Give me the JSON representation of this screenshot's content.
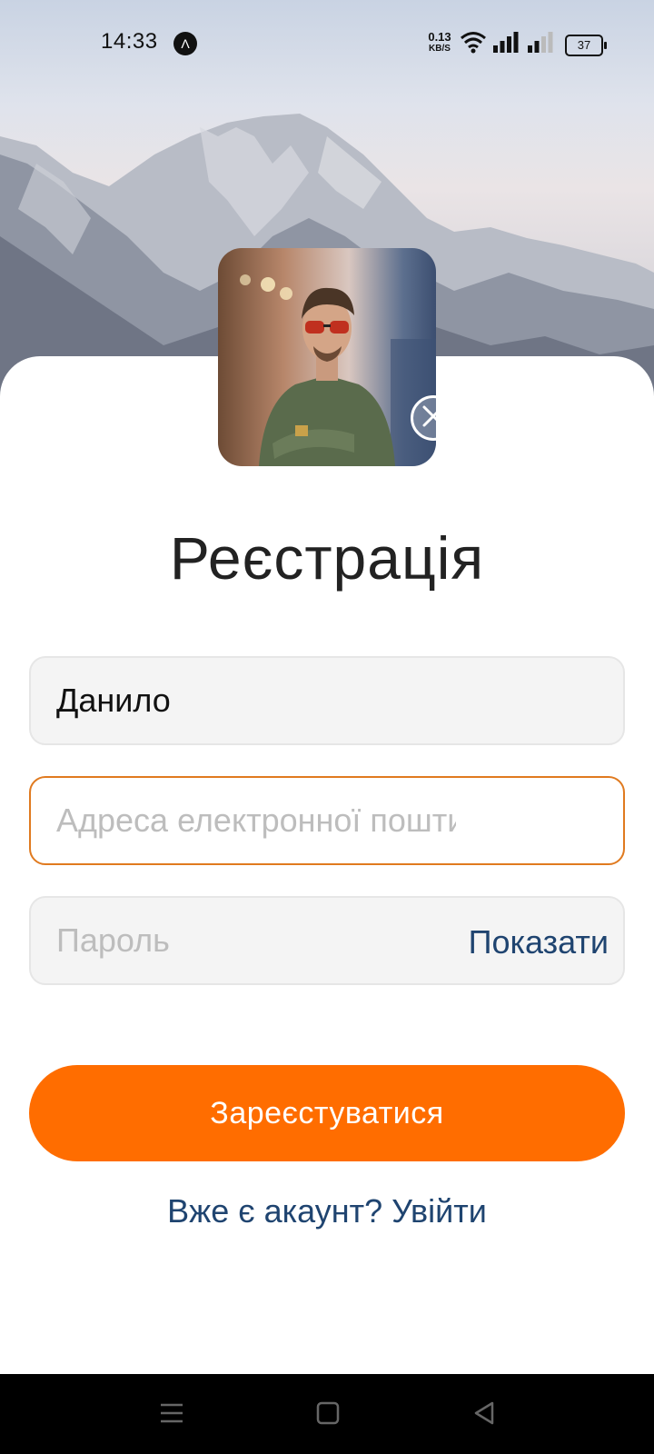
{
  "status_bar": {
    "time": "14:33",
    "nav_badge": "Λ",
    "net_speed_value": "0.13",
    "net_speed_unit": "KB/S",
    "battery": "37"
  },
  "icons": {
    "wifi": "wifi-icon",
    "signal1": "signal-icon",
    "signal2": "signal-weak-icon",
    "remove": "close-icon",
    "nav_menu": "menu-icon",
    "nav_home": "home-square-icon",
    "nav_back": "back-triangle-icon"
  },
  "form": {
    "title": "Реєстрація",
    "name_value": "Данило",
    "email_placeholder": "Адреса електронної пошти",
    "password_placeholder": "Пароль",
    "show_password_label": "Показати",
    "submit_label": "Зареєстуватися",
    "login_link": "Вже є акаунт? Увійти"
  },
  "colors": {
    "accent": "#ff6d00",
    "focus_border": "#e07a1f",
    "link": "#1f4470",
    "field_bg": "#f4f4f4"
  }
}
